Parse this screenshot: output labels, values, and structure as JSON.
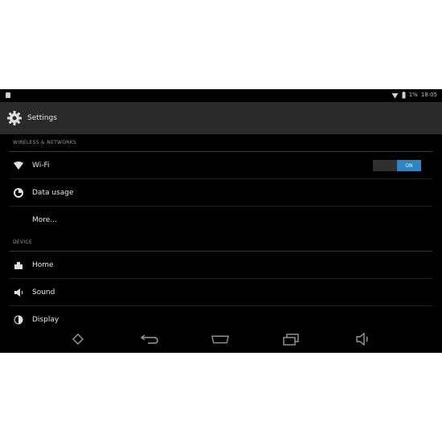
{
  "status_bar": {
    "battery": "1%",
    "time": "18:05",
    "icons": [
      "notification-icon",
      "wifi-icon",
      "signal-icon",
      "battery-icon"
    ]
  },
  "action_bar": {
    "title": "Settings",
    "icon": "gear-icon"
  },
  "sections": {
    "wireless": {
      "header": "WIRELESS & NETWORKS"
    },
    "device": {
      "header": "DEVICE"
    }
  },
  "items": {
    "wifi": {
      "label": "Wi-Fi",
      "icon": "wifi-icon",
      "toggle_state": "ON"
    },
    "data_usage": {
      "label": "Data usage",
      "icon": "data-usage-icon"
    },
    "more": {
      "label": "More..."
    },
    "home": {
      "label": "Home",
      "icon": "home-icon"
    },
    "sound": {
      "label": "Sound",
      "icon": "sound-icon"
    },
    "display": {
      "label": "Display",
      "icon": "display-icon"
    }
  },
  "nav_bar": {
    "buttons": [
      "power-icon",
      "back-icon",
      "home-icon",
      "recent-apps-icon",
      "volume-icon"
    ]
  },
  "colors": {
    "screen_bg": "#000000",
    "action_bar_bg": "#2a2a2a",
    "toggle_on": "#2d86c3",
    "text": "#e6e6e6"
  }
}
